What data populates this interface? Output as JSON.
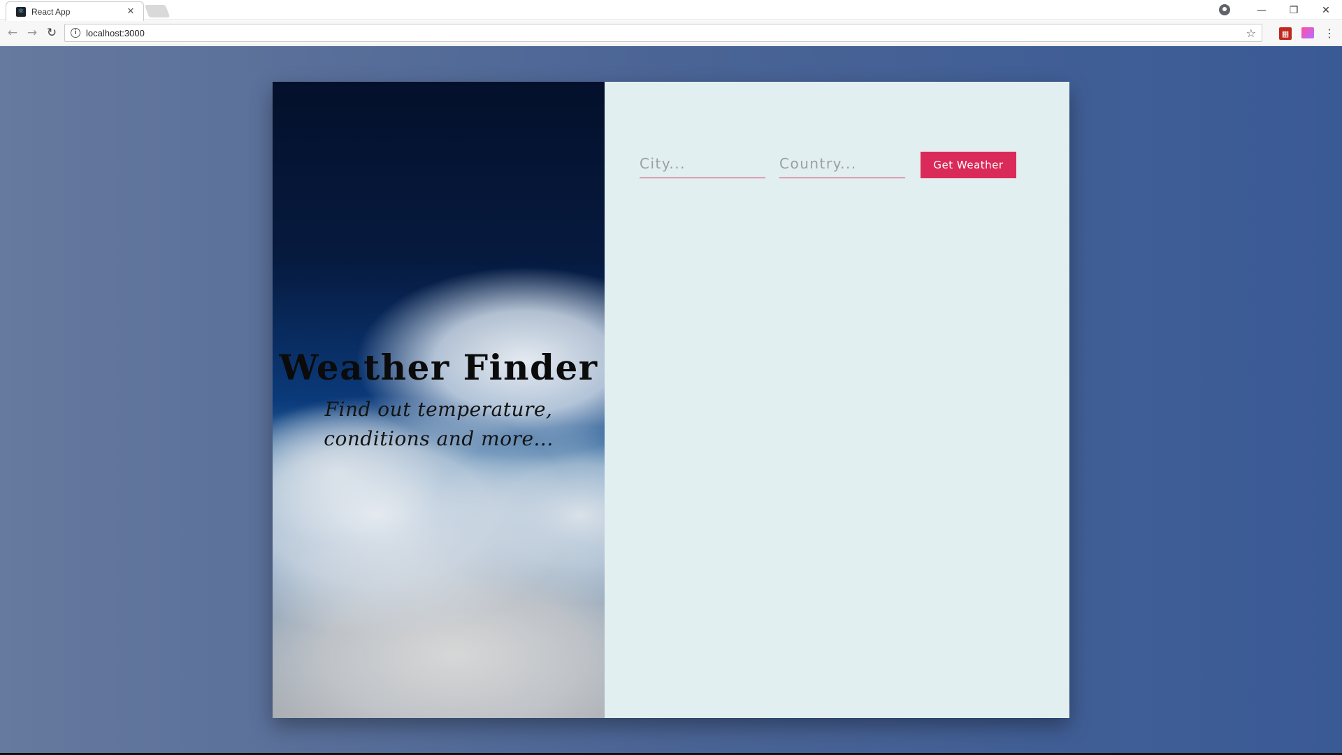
{
  "browser": {
    "tab_title": "React App",
    "tab_close": "✕",
    "url": "localhost:3000",
    "back_glyph": "←",
    "forward_glyph": "→",
    "reload_glyph": "↻",
    "info_glyph": "i",
    "star_glyph": "☆",
    "menu_glyph": "⋮",
    "minimize_glyph": "—",
    "restore_glyph": "❐",
    "close_glyph": "✕"
  },
  "hero": {
    "title": "Weather Finder",
    "subtitle": "Find out temperature, conditions and more..."
  },
  "form": {
    "city_placeholder": "City...",
    "country_placeholder": "Country...",
    "submit_label": "Get Weather"
  },
  "colors": {
    "accent": "#da2a59",
    "panel_bg": "#e2eff1",
    "page_bg": "#4a6495"
  }
}
